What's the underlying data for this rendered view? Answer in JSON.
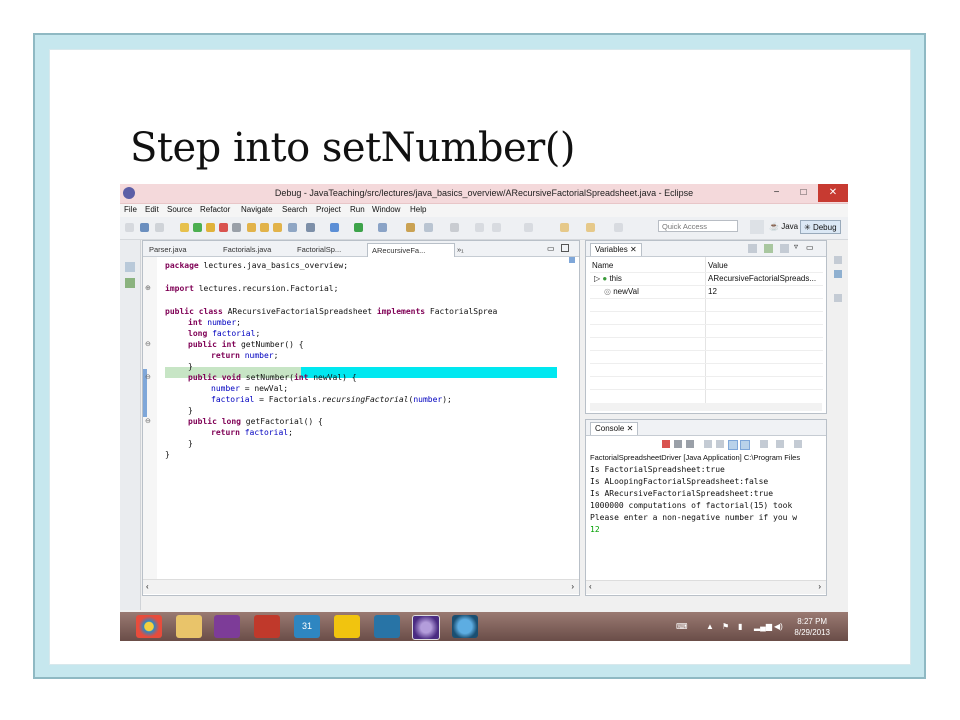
{
  "slide": {
    "title": "Step into setNumber()"
  },
  "window": {
    "title": "Debug - JavaTeaching/src/lectures/java_basics_overview/ARecursiveFactorialSpreadsheet.java - Eclipse",
    "minimize": "−",
    "maximize": "□",
    "close": "✕"
  },
  "menu": [
    "File",
    "Edit",
    "Source",
    "Refactor",
    "Navigate",
    "Search",
    "Project",
    "Run",
    "Window",
    "Help"
  ],
  "toolbar": {
    "quick_access_placeholder": "Quick Access",
    "java_perspective": "Java",
    "debug_perspective": "Debug"
  },
  "editor": {
    "tabs": [
      "Parser.java",
      "Factorials.java",
      "FactorialSp...",
      "ARecursiveFa...",
      "»₁"
    ],
    "lines": {
      "l1_kw": "package",
      "l1_rest": " lectures.java_basics_overview;",
      "l2_kw": "import",
      "l2_rest": " lectures.recursion.Factorial;",
      "l3_kw1": "public class",
      "l3_name": " ARecursiveFactorialSpreadsheet ",
      "l3_kw2": "implements",
      "l3_rest": " FactorialSprea",
      "l4_kw": "int",
      "l4_fld": " number",
      "l4_rest": ";",
      "l5_kw": "long",
      "l5_fld": " factorial",
      "l5_rest": ";",
      "l6_kw": "public int",
      "l6_rest": " getNumber() {",
      "l7_kw": "return",
      "l7_fld": " number",
      "l7_rest": ";",
      "l8": "}",
      "l9_kw": "public void",
      "l9_rest1": " setNumber(",
      "l9_kw2": "int",
      "l9_rest2": " newVal) {",
      "l10_fld": "number",
      "l10_rest": " = newVal;",
      "l11_fld": "factorial",
      "l11_rest1": " = Factorials.",
      "l11_it": "recursingFactorial",
      "l11_rest2": "(",
      "l11_fld2": "number",
      "l11_rest3": ");",
      "l12": "}",
      "l13_kw": "public long",
      "l13_rest": " getFactorial() {",
      "l14_kw": "return",
      "l14_fld": " factorial",
      "l14_rest": ";",
      "l15": "}",
      "l16": "}"
    }
  },
  "variables": {
    "tab": "Variables",
    "col_name": "Name",
    "col_value": "Value",
    "rows": [
      {
        "name": "this",
        "value": "ARecursiveFactorialSpreads..."
      },
      {
        "name": "newVal",
        "value": "12"
      }
    ]
  },
  "console": {
    "tab": "Console",
    "header": "FactorialSpreadsheetDriver [Java Application] C:\\Program Files",
    "lines": [
      "Is FactorialSpreadsheet:true",
      "Is ALoopingFactorialSpreadsheet:false",
      "Is ARecursiveFactorialSpreadsheet:true",
      "1000000 computations of factorial(15) took",
      "Please enter a non-negative number if you w"
    ],
    "input": "12",
    "input_color": "#00a000"
  },
  "taskbar": {
    "time": "8:27 PM",
    "date": "8/29/2013",
    "calendar_day": "31"
  },
  "colors": {
    "highlight_line": "#c7e5c5",
    "cursor_highlight": "#00e8f0",
    "keyword": "#7f0055",
    "field": "#0000c0",
    "close_button": "#c73a31"
  }
}
